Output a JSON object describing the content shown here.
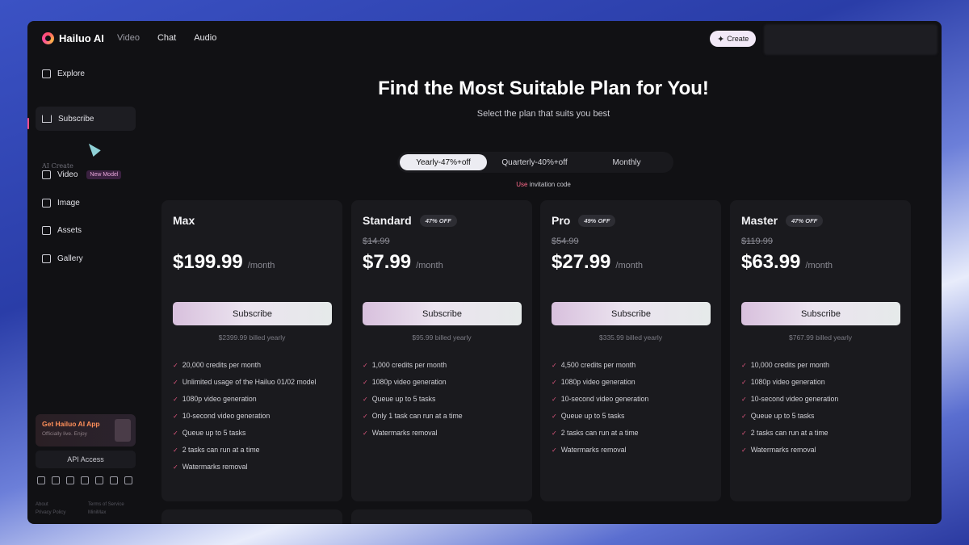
{
  "topbar": {
    "logo_text": "Hailuo AI",
    "nav": [
      "Video",
      "Chat",
      "Audio"
    ],
    "create_label": "Create"
  },
  "sidebar": {
    "items": [
      {
        "label": "Explore"
      },
      {
        "label": "Subscribe"
      },
      {
        "label": "Video",
        "badge": "New Model"
      },
      {
        "label": "Image"
      },
      {
        "label": "Assets"
      },
      {
        "label": "Gallery"
      }
    ],
    "section_label": "AI Create",
    "promo_title": "Get Hailuo AI App",
    "promo_sub": "Officially live. Enjoy",
    "api_label": "API Access",
    "footer_links": [
      "About",
      "Terms of Service",
      "Privacy Policy",
      "MiniMax"
    ]
  },
  "main": {
    "headline": "Find the Most Suitable Plan for You!",
    "subline": "Select the plan that suits you best",
    "toggle": [
      "Yearly-47%+off",
      "Quarterly-40%+off",
      "Monthly"
    ],
    "invite_accent": "Use",
    "invite_rest": "invitation code"
  },
  "plans": [
    {
      "name": "Max",
      "off": "",
      "old_price": "",
      "price": "$199.99",
      "per": "/month",
      "subscribe": "Subscribe",
      "billed": "$2399.99 billed yearly",
      "features": [
        "20,000 credits per month",
        "Unlimited usage of the Hailuo 01/02 model",
        "1080p video generation",
        "10-second video generation",
        "Queue up to 5 tasks",
        "2 tasks can run at a time",
        "Watermarks removal"
      ]
    },
    {
      "name": "Standard",
      "off": "47% OFF",
      "old_price": "$14.99",
      "price": "$7.99",
      "per": "/month",
      "subscribe": "Subscribe",
      "billed": "$95.99 billed yearly",
      "features": [
        "1,000 credits per month",
        "1080p video generation",
        "Queue up to 5 tasks",
        "Only 1 task can run at a time",
        "Watermarks removal"
      ]
    },
    {
      "name": "Pro",
      "off": "49% OFF",
      "old_price": "$54.99",
      "price": "$27.99",
      "per": "/month",
      "subscribe": "Subscribe",
      "billed": "$335.99 billed yearly",
      "features": [
        "4,500 credits per month",
        "1080p video generation",
        "10-second video generation",
        "Queue up to 5 tasks",
        "2 tasks can run at a time",
        "Watermarks removal"
      ]
    },
    {
      "name": "Master",
      "off": "47% OFF",
      "old_price": "$119.99",
      "price": "$63.99",
      "per": "/month",
      "subscribe": "Subscribe",
      "billed": "$767.99 billed yearly",
      "features": [
        "10,000 credits per month",
        "1080p video generation",
        "10-second video generation",
        "Queue up to 5 tasks",
        "2 tasks can run at a time",
        "Watermarks removal"
      ]
    }
  ],
  "icons": {
    "explore": "calendar-icon",
    "subscribe": "crown-icon",
    "video": "video-icon",
    "image": "image-icon",
    "assets": "folder-icon",
    "gallery": "gallery-icon",
    "check": "check-icon"
  },
  "colors": {
    "accent": "#ff4d8a",
    "background": "#111114",
    "card": "#1a1a1e"
  }
}
